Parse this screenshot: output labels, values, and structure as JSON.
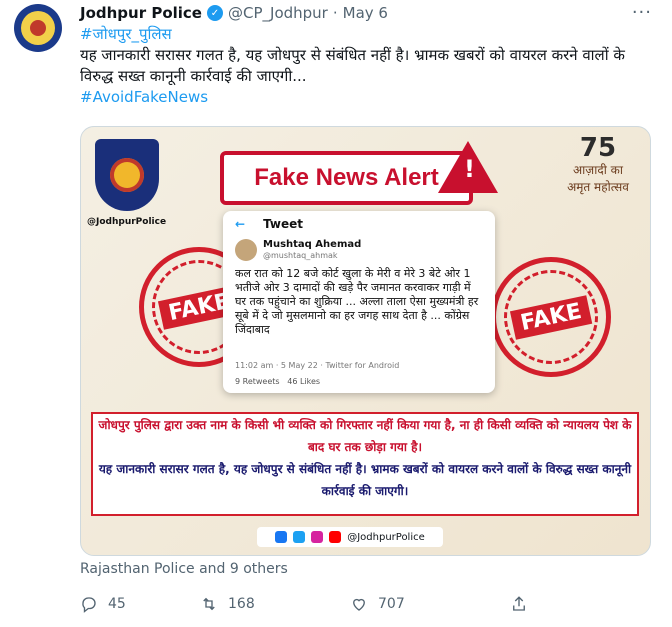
{
  "tweet": {
    "author_name": "Jodhpur Police",
    "handle": "@CP_Jodhpur",
    "separator": "·",
    "date": "May 6",
    "hashtag_top": "#जोधपुर_पुलिस",
    "text": "यह जानकारी सरासर गलत है, यह जोधपुर से संबंधित नहीं है। भ्रामक खबरों को वायरल करने वालों के विरुद्ध सख्त कानूनी कार्रवाई की जाएगी...",
    "hashtag_bottom": "#AvoidFakeNews",
    "liked_by": "Rajasthan Police and 9 others",
    "replies": "45",
    "retweets": "168",
    "likes": "707"
  },
  "media": {
    "logo_handle": "@JodhpurPolice",
    "alert_title": "Fake News Alert",
    "warn_symbol": "!",
    "azadi_number": "75",
    "azadi_line1": "आज़ादी का",
    "azadi_line2": "अमृत महोत्सव",
    "stamp_word": "FAKE",
    "inner_tweet": {
      "header": "Tweet",
      "name": "Mushtaq Ahemad",
      "handle": "@mushtaq_ahmak",
      "text": "कल रात को 12 बजे कोर्ट खुला के मेरी व मेरे 3 बेटे ओर 1 भतीजे ओर 3 दामादों की खड़े पैर जमानत करवाकर गाड़ी में घर तक पहुंचाने का शुक्रिया ... अल्ला ताला ऐसा मुख्यमंत्री हर सूबे में दे जो मुसलमानो का हर जगह साथ देता है ... कोंग्रेस जिंदाबाद",
      "time": "11:02 am · 5 May 22 · Twitter for Android",
      "retweets": "9 Retweets",
      "likes": "46 Likes"
    },
    "notice_line1": "जोधपुर पुलिस द्वारा उक्त नाम के किसी भी व्यक्ति को गिरफ्तार नहीं किया गया है, ना ही किसी व्यक्ति को न्यायलय पेश के बाद घर तक छोड़ा गया है।",
    "notice_line2": "यह जानकारी सरासर गलत है, यह जोधपुर से संबंधित नहीं है। भ्रामक खबरों को वायरल करने वालों के विरुद्ध सख्त कानूनी कार्रवाई की जाएगी।",
    "social_handle": "@JodhpurPolice"
  },
  "icons": {
    "verified": "verified-badge-icon",
    "more": "more-icon",
    "reply": "reply-icon",
    "retweet": "retweet-icon",
    "like": "heart-icon",
    "share": "share-icon"
  },
  "colors": {
    "accent": "#1d9bf0",
    "alert": "#c8102e"
  }
}
